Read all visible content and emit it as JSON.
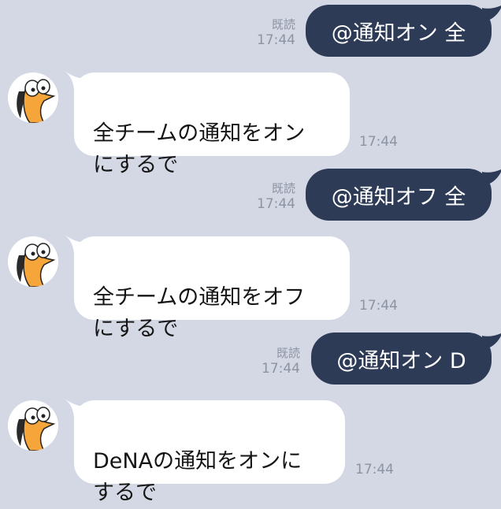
{
  "messages": [
    {
      "direction": "out",
      "text": "@通知オン 全",
      "read_label": "既読",
      "time": "17:44"
    },
    {
      "direction": "in",
      "text": "全チームの通知をオン\nにするで",
      "time": "17:44"
    },
    {
      "direction": "out",
      "text": "@通知オフ 全",
      "read_label": "既読",
      "time": "17:44"
    },
    {
      "direction": "in",
      "text": "全チームの通知をオフ\nにするで",
      "time": "17:44"
    },
    {
      "direction": "out",
      "text": "@通知オン D",
      "read_label": "既読",
      "time": "17:44"
    },
    {
      "direction": "in",
      "text": "DeNAの通知をオンに\nするで",
      "time": "17:44"
    }
  ],
  "colors": {
    "background": "#d4d8e4",
    "outgoing_bubble": "#2e3b57",
    "incoming_bubble": "#ffffff",
    "meta_text": "#8c93a3",
    "avatar_character": "#f5a53a"
  },
  "icons": {
    "avatar": "orange-cartoon-character-icon"
  }
}
